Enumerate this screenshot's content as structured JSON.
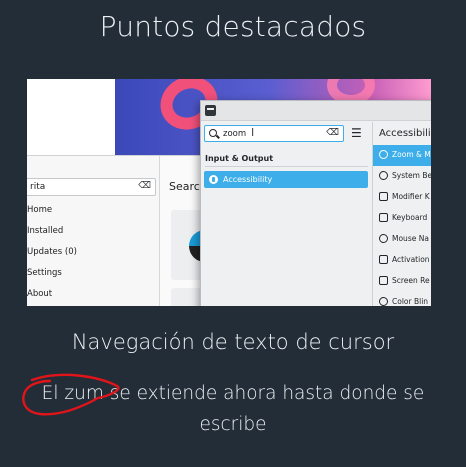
{
  "page": {
    "title": "Puntos destacados",
    "caption_title": "Navegación de texto de cursor",
    "caption_description": "El zum se extiende ahora hasta donde se escribe",
    "annotation_color": "#e1141a"
  },
  "screenshot": {
    "background_app": {
      "search_value": "rita",
      "search_label": "Searc",
      "sidebar_items": [
        "Home",
        "Installed",
        "Updates (0)",
        "Settings",
        "About"
      ]
    },
    "settings_window": {
      "search_value": "zoom",
      "heading": "Accessibili",
      "category_label": "Input & Output",
      "result_item": "Accessibility",
      "list_items": [
        {
          "label": "Zoom & M",
          "icon": "zoom-icon",
          "selected": true
        },
        {
          "label": "System Be",
          "icon": "bell-icon",
          "selected": false
        },
        {
          "label": "Modifier K",
          "icon": "modifier-keys-icon",
          "selected": false
        },
        {
          "label": "Keyboard",
          "icon": "keyboard-icon",
          "selected": false
        },
        {
          "label": "Mouse Na",
          "icon": "mouse-icon",
          "selected": false
        },
        {
          "label": "Activation",
          "icon": "activation-icon",
          "selected": false
        },
        {
          "label": "Screen Re",
          "icon": "screen-reader-icon",
          "selected": false
        },
        {
          "label": "Color Blin",
          "icon": "color-blindness-icon",
          "selected": false
        }
      ]
    }
  }
}
